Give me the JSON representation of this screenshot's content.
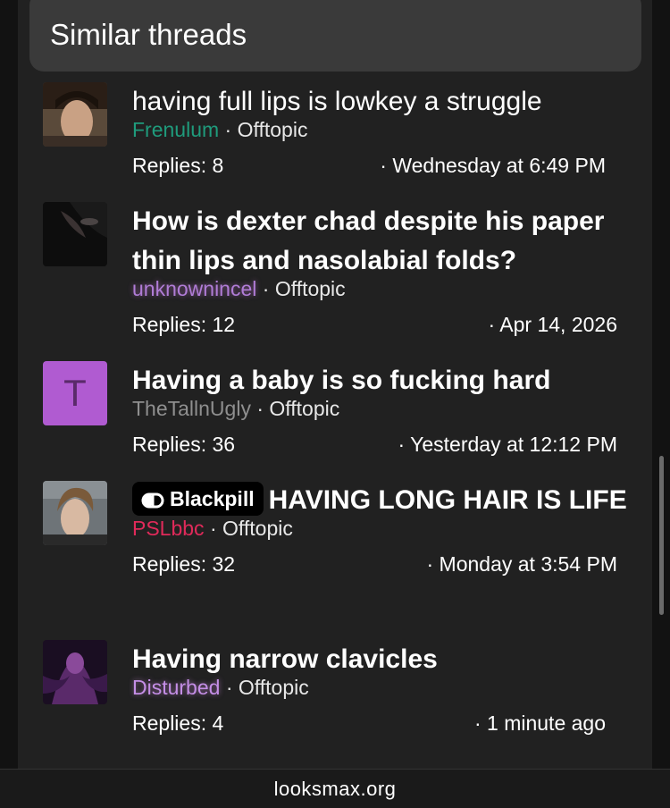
{
  "header": {
    "title": "Similar threads"
  },
  "threads": [
    {
      "title": "having full lips is lowkey a struggle",
      "user": "Frenulum",
      "forum": "Offtopic",
      "replies": "Replies: 8",
      "date": "Wednesday at 6:49 PM"
    },
    {
      "title": "How is dexter chad despite his paper thin lips and nasolabial folds?",
      "user": "unknownincel",
      "forum": "Offtopic",
      "replies": "Replies: 12",
      "date": "Apr 14, 2026"
    },
    {
      "avatar_letter": "T",
      "title": "Having a baby is so fucking hard",
      "user": "TheTallnUgly",
      "forum": "Offtopic",
      "replies": "Replies: 36",
      "date": "Yesterday at 12:12 PM"
    },
    {
      "prefix": "Blackpill",
      "title": "HAVING LONG HAIR IS LIFE",
      "user": "PSLbbc",
      "forum": "Offtopic",
      "replies": "Replies: 32",
      "date": "Monday at 3:54 PM"
    },
    {
      "title": "Having narrow clavicles",
      "user": "Disturbed",
      "forum": "Offtopic",
      "replies": "Replies: 4",
      "date": "1 minute ago"
    }
  ],
  "footer": {
    "domain": "looksmax.org"
  },
  "icons": {
    "badge_icon": "pill-icon"
  },
  "colors": {
    "accent_purple": "#b05bd1",
    "user_green": "#1f9b7c",
    "user_red": "#e02a5a"
  }
}
